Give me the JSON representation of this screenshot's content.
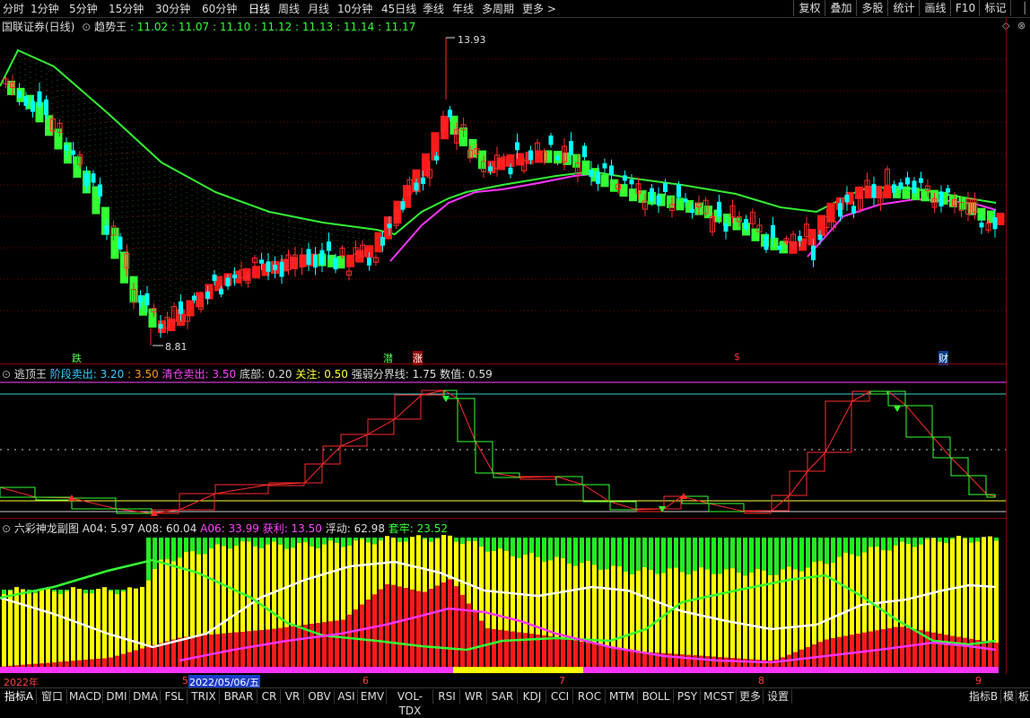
{
  "toolbar": {
    "periods": [
      "分时",
      "1分钟",
      "5分钟",
      "15分钟",
      "30分钟",
      "60分钟",
      "日线",
      "周线",
      "月线",
      "10分钟",
      "45日线",
      "季线",
      "年线",
      "多周期",
      "更多 >"
    ],
    "active_period": "日线",
    "right_buttons": [
      "复权",
      "叠加",
      "多股",
      "统计",
      "画线",
      "F10",
      "标记"
    ]
  },
  "main_panel": {
    "stock": "国联证券(日线)",
    "indicator": "趋势王",
    "values": ": 11.02 : 11.07 : 11.10 : 11.12 : 11.13 : 11.14 : 11.17",
    "high_label": "13.93",
    "low_label": "8.81",
    "markers": [
      {
        "text": "跌",
        "color": "#55ff55"
      },
      {
        "text": "潜",
        "color": "#55ff55"
      },
      {
        "text": "涨",
        "color": "#ffffff"
      },
      {
        "text": "$",
        "color": "#ff3030"
      },
      {
        "text": "财",
        "color": "#ffffff"
      }
    ]
  },
  "escape_panel": {
    "name": "逃顶王",
    "items": [
      {
        "label": "阶段卖出: ",
        "value": "3.20",
        "color": "#33ccff"
      },
      {
        "label": ": ",
        "value": "3.50",
        "color": "#ff9900"
      },
      {
        "label": "清仓卖出: ",
        "value": "3.50",
        "color": "#ff44ff"
      },
      {
        "label": "底部: ",
        "value": "0.20",
        "color": "#dddddd"
      },
      {
        "label": "关注: ",
        "value": "0.50",
        "color": "#ffff33"
      },
      {
        "label": "强弱分界线: ",
        "value": "1.75",
        "color": "#dddddd"
      },
      {
        "label": "数值: ",
        "value": "0.59",
        "color": "#dddddd"
      }
    ]
  },
  "dragon_panel": {
    "name": "六彩神龙副图",
    "items": [
      {
        "label": "A04: ",
        "value": "5.97",
        "color": "#dddddd"
      },
      {
        "label": "A08: ",
        "value": "60.04",
        "color": "#dddddd"
      },
      {
        "label": "A06: ",
        "value": "33.99",
        "color": "#ff44ff"
      },
      {
        "label": "获利: ",
        "value": "13.50",
        "color": "#ff44ff"
      },
      {
        "label": "浮动: ",
        "value": "62.98",
        "color": "#dddddd"
      },
      {
        "label": "套牢: ",
        "value": "23.52",
        "color": "#33ff33"
      }
    ]
  },
  "datebar": {
    "year": "2022年",
    "cursor_date": "2022/05/06/五",
    "months": [
      "6",
      "7",
      "8",
      "9"
    ],
    "mark5": "5"
  },
  "bottom_tabs": [
    "指标A",
    "窗口",
    "MACD",
    "DMI",
    "DMA",
    "FSL",
    "TRIX",
    "BRAR",
    "CR",
    "VR",
    "OBV",
    "ASI",
    "EMV",
    "VOL-TDX",
    "RSI",
    "WR",
    "SAR",
    "KDJ",
    "CCI",
    "ROC",
    "MTM",
    "BOLL",
    "PSY",
    "MCST",
    "更多",
    "设置"
  ],
  "bottom_right": [
    "指标B",
    "模",
    "板"
  ],
  "colors": {
    "up": "#ff2a2a",
    "down": "#00ffff",
    "green_block": "#33ff33",
    "red_block": "#ff1a1a",
    "magenta": "#ff33ff",
    "yellow": "#ffff00"
  }
}
